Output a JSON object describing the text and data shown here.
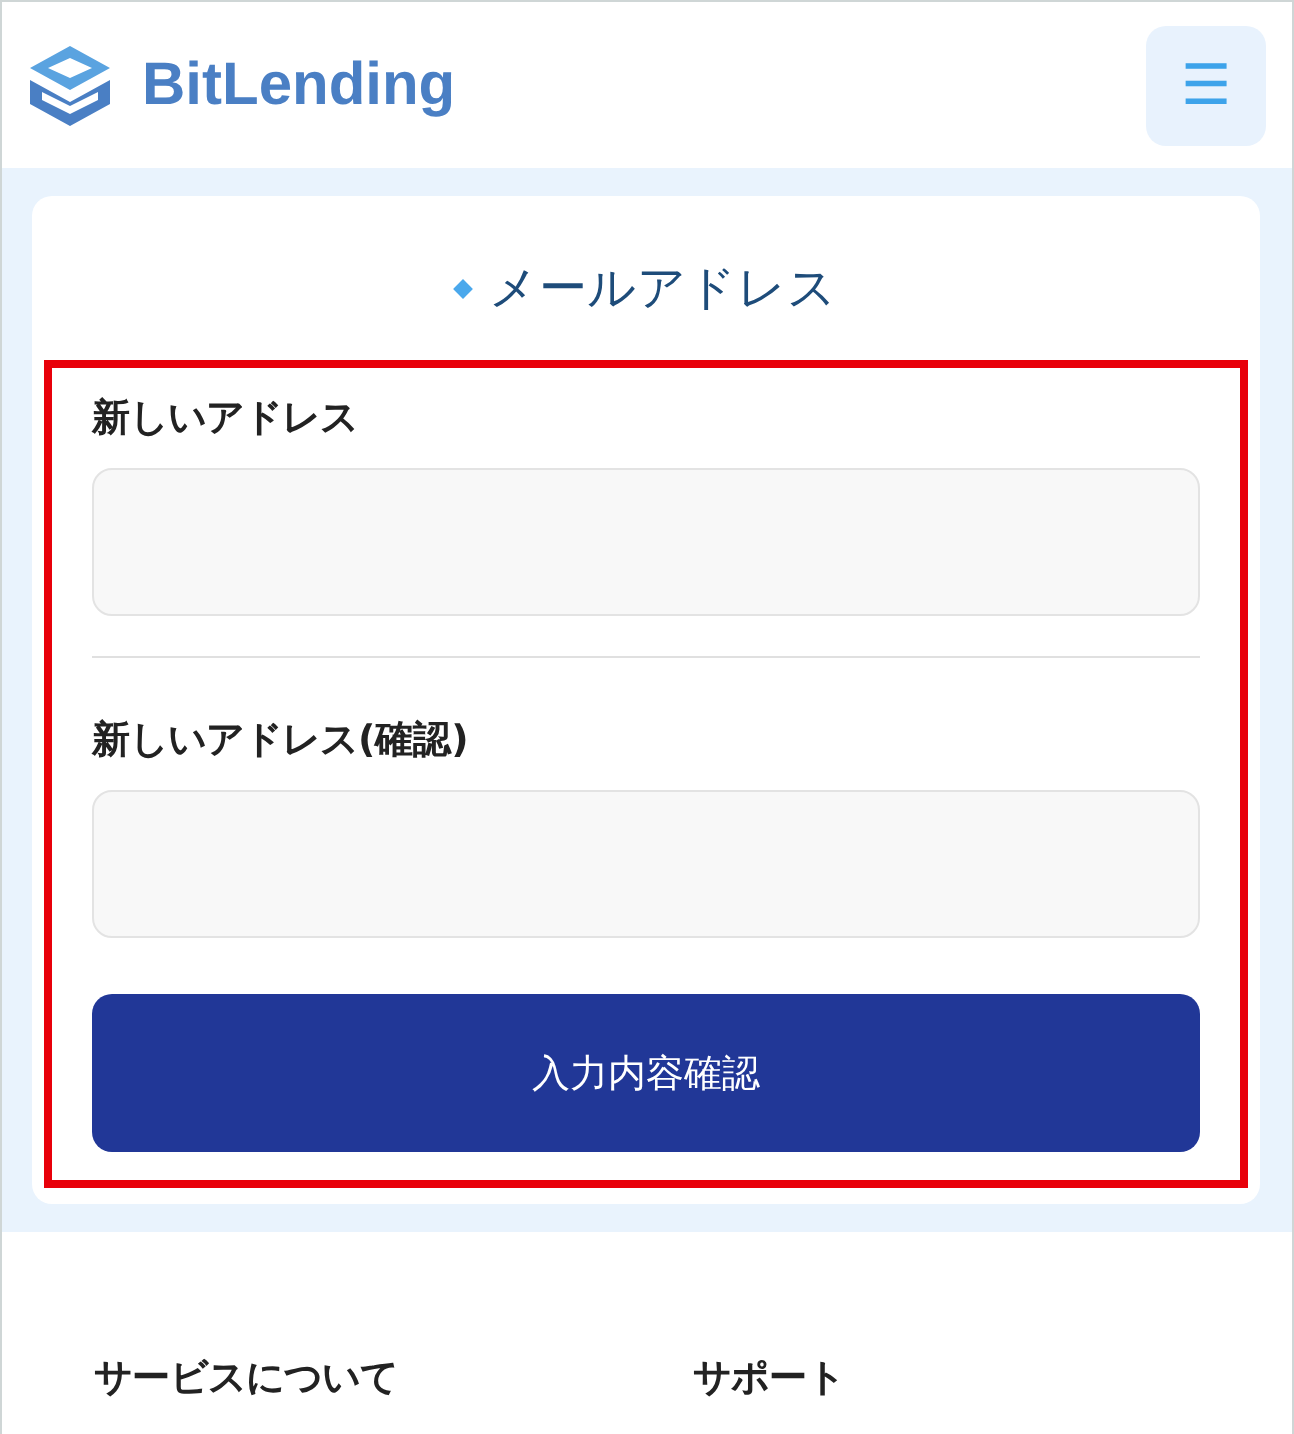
{
  "header": {
    "logo": "BitLending",
    "menu_icon": "☰"
  },
  "card": {
    "title": "メールアドレス",
    "highlighted": true,
    "fields": [
      {
        "label": "新しいアドレス"
      },
      {
        "label": "新しいアドレス(確認)"
      }
    ],
    "button": "入力内容確認"
  },
  "footer": {
    "headings": [
      "サービスについて",
      "サポート"
    ]
  }
}
